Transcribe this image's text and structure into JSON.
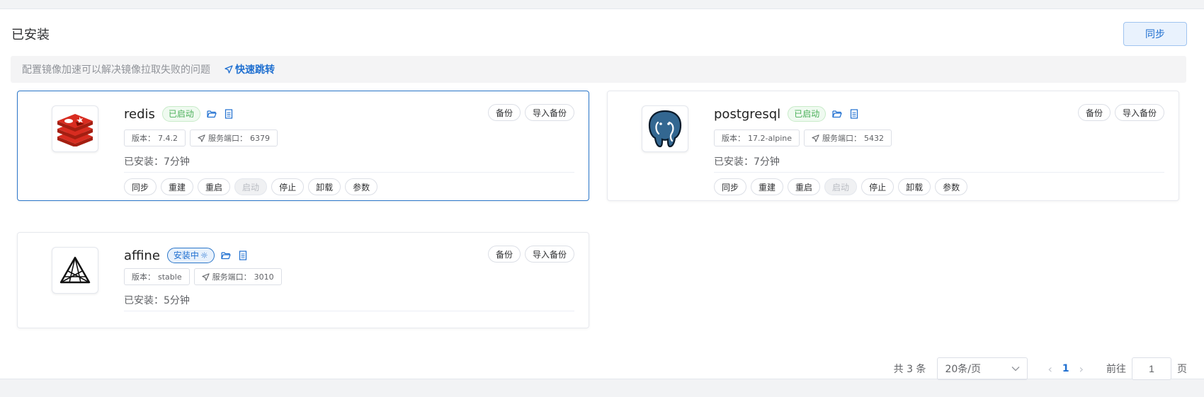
{
  "page": {
    "title": "已安装",
    "sync_label": "同步"
  },
  "notice": {
    "text": "配置镜像加速可以解决镜像拉取失败的问题",
    "link": "快速跳转"
  },
  "apps": [
    {
      "name": "redis",
      "status": "已启动",
      "status_color": "green",
      "backup": "备份",
      "import_backup": "导入备份",
      "version_label": "版本：",
      "version": "7.4.2",
      "port_label": "服务端口：",
      "port": "6379",
      "installed_label": "已安装：",
      "installed": "7分钟",
      "ops": [
        "同步",
        "重建",
        "重启",
        "启动",
        "停止",
        "卸载",
        "参数"
      ],
      "disabled_op": "启动",
      "icon": "redis-logo-icon"
    },
    {
      "name": "postgresql",
      "status": "已启动",
      "status_color": "green",
      "backup": "备份",
      "import_backup": "导入备份",
      "version_label": "版本：",
      "version": "17.2-alpine",
      "port_label": "服务端口：",
      "port": "5432",
      "installed_label": "已安装：",
      "installed": "7分钟",
      "ops": [
        "同步",
        "重建",
        "重启",
        "启动",
        "停止",
        "卸载",
        "参数"
      ],
      "disabled_op": "启动",
      "icon": "postgresql-elephant-icon"
    },
    {
      "name": "affine",
      "status": "安装中",
      "status_color": "blue",
      "backup": "备份",
      "import_backup": "导入备份",
      "version_label": "版本：",
      "version": "stable",
      "port_label": "服务端口：",
      "port": "3010",
      "installed_label": "已安装：",
      "installed": "5分钟",
      "icon": "affine-logo-icon"
    }
  ],
  "pagination": {
    "total_text": "共 3 条",
    "page_size": "20条/页",
    "current_page": "1",
    "goto_label": "前往",
    "goto_value": "1",
    "page_suffix": "页"
  },
  "colors": {
    "accent": "#1f6fd0",
    "success": "#4bb05a",
    "redis_red": "#d82c20",
    "pg_blue": "#336791"
  }
}
